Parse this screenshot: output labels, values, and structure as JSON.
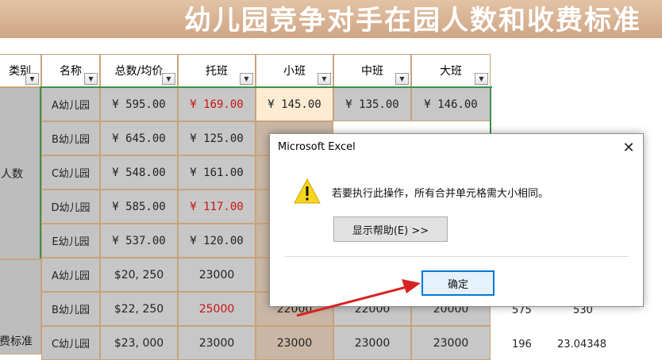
{
  "title": "幼儿园竞争对手在园人数和收费标准",
  "headers": [
    "类别",
    "名称",
    "总数/均价",
    "托班",
    "小班",
    "中班",
    "大班"
  ],
  "categories": {
    "count": "人数",
    "fee": "费标准"
  },
  "rows": [
    {
      "name": "A幼儿园",
      "total": "¥ 595.00",
      "tuo": "¥ 169.00",
      "xiao": "¥ 145.00",
      "zhong": "¥ 135.00",
      "da": "¥ 146.00"
    },
    {
      "name": "B幼儿园",
      "total": "¥ 645.00",
      "tuo": "¥ 125.00",
      "xiao": "",
      "zhong": "",
      "da": ""
    },
    {
      "name": "C幼儿园",
      "total": "¥ 548.00",
      "tuo": "¥ 161.00",
      "xiao": "",
      "zhong": "",
      "da": ""
    },
    {
      "name": "D幼儿园",
      "total": "¥ 585.00",
      "tuo": "¥ 117.00",
      "xiao": "",
      "zhong": "",
      "da": ""
    },
    {
      "name": "E幼儿园",
      "total": "¥ 537.00",
      "tuo": "¥ 120.00",
      "xiao": "",
      "zhong": "",
      "da": ""
    },
    {
      "name": "A幼儿园",
      "total": "$20, 250",
      "tuo": "23000",
      "xiao": "",
      "zhong": "",
      "da": ""
    },
    {
      "name": "B幼儿园",
      "total": "$22, 250",
      "tuo": "25000",
      "xiao": "22000",
      "zhong": "22000",
      "da": "20000"
    },
    {
      "name": "C幼儿园",
      "total": "$23, 000",
      "tuo": "23000",
      "xiao": "23000",
      "zhong": "23000",
      "da": "23000"
    }
  ],
  "outside": {
    "b1": "575",
    "b2": "530",
    "c1": "196",
    "c2": "23.04348"
  },
  "dialog": {
    "title": "Microsoft Excel",
    "close": "✕",
    "message": "若要执行此操作，所有合并单元格需大小相同。",
    "help": "显示帮助(E) >>",
    "ok": "确定"
  },
  "colors": {
    "accent_red": "#c81414",
    "dialog_focus": "#0078d7",
    "border_green": "#3f8f4a"
  }
}
